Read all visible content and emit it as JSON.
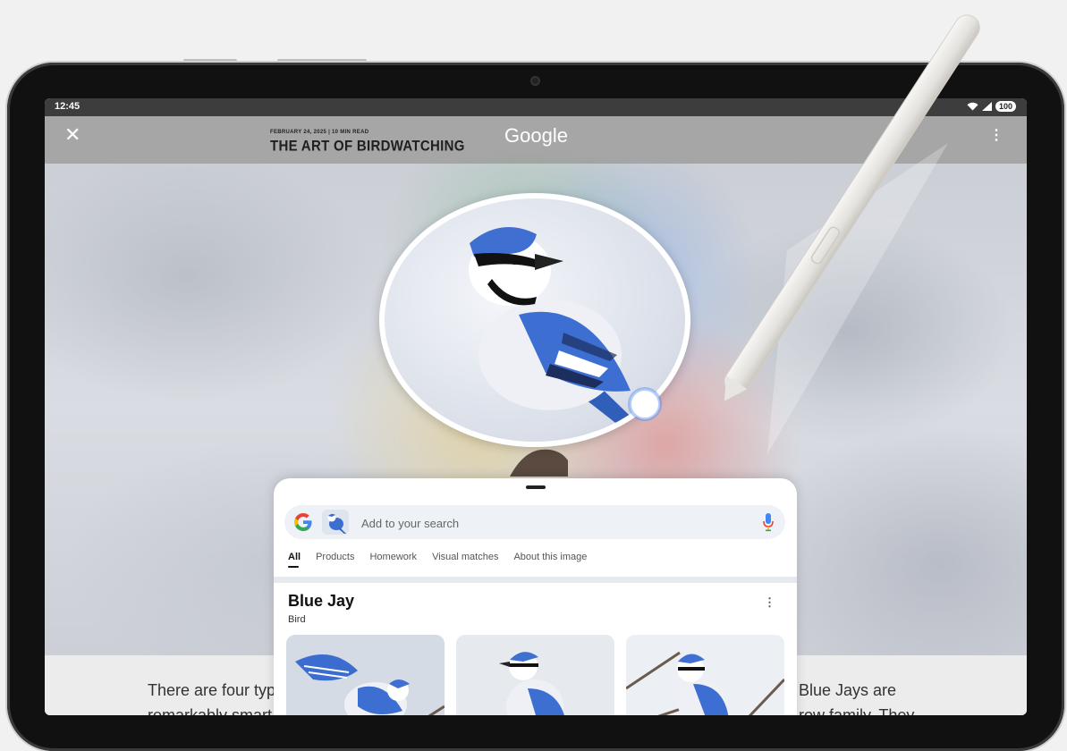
{
  "status_bar": {
    "time": "12:45",
    "battery": "100"
  },
  "app_bar": {
    "article_meta": "FEBRUARY 24, 2025 | 10 MIN READ",
    "article_title": "THE ART OF BIRDWATCHING",
    "brand": "Google"
  },
  "article_body": {
    "left_line1": "There are four typ",
    "left_line2": "remarkably smart",
    "right_line1": "Blue Jays are",
    "right_line2": "row family. They"
  },
  "search_sheet": {
    "placeholder": "Add to your search",
    "tabs": [
      {
        "label": "All"
      },
      {
        "label": "Products"
      },
      {
        "label": "Homework"
      },
      {
        "label": "Visual matches"
      },
      {
        "label": "About this image"
      }
    ],
    "result": {
      "title": "Blue Jay",
      "subtitle": "Bird"
    }
  },
  "icons": [
    "close-icon",
    "more-vert-icon",
    "wifi-icon",
    "signal-icon",
    "google-g-icon",
    "mic-icon"
  ],
  "colors": {
    "google_blue": "#4285F4",
    "google_red": "#EA4335",
    "google_yellow": "#FBBC05",
    "google_green": "#34A853"
  }
}
